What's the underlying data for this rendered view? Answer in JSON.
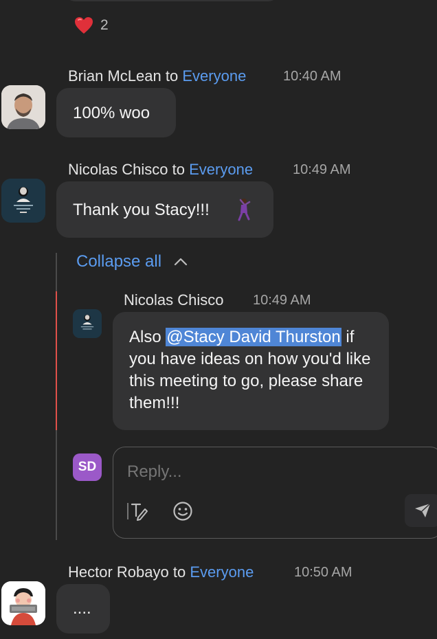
{
  "colors": {
    "background": "#232323",
    "bubble": "#333334",
    "link": "#5b9cf0",
    "thread_line": "#e0504a",
    "mention_highlight": "#4f86d6",
    "sd_avatar": "#9b59c8"
  },
  "reaction": {
    "icon": "heart-emoji",
    "count": "2"
  },
  "messages": [
    {
      "sender": "Brian McLean",
      "to_word": "to",
      "recipient": "Everyone",
      "time": "10:40 AM",
      "text": "100% woo"
    },
    {
      "sender": "Nicolas Chisco",
      "to_word": "to",
      "recipient": "Everyone",
      "time": "10:49 AM",
      "text": "Thank you Stacy!!!",
      "emoji": "dancing-woman-emoji"
    },
    {
      "sender": "Hector Robayo",
      "to_word": "to",
      "recipient": "Everyone",
      "time": "10:50 AM",
      "text": "...."
    }
  ],
  "thread": {
    "collapse_label": "Collapse all",
    "reply": {
      "sender": "Nicolas Chisco",
      "time": "10:49 AM",
      "text_before": "Also ",
      "mention": "@Stacy David Thurston",
      "text_after": "if you have ideas on how you'd like this meeting to go, please share them!!!"
    },
    "composer": {
      "avatar_initials": "SD",
      "placeholder": "Reply...",
      "icons": [
        "format-text-icon",
        "emoji-icon",
        "send-icon"
      ]
    }
  }
}
